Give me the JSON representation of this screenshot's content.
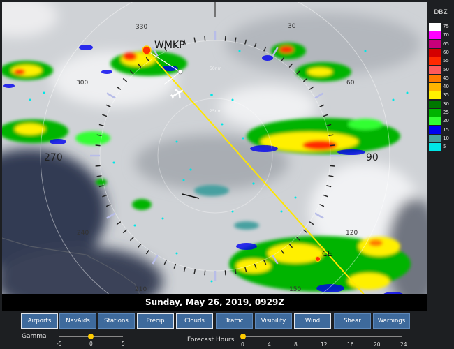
{
  "timestamp": "Sunday, May 26, 2019, 0929Z",
  "legend": {
    "title": "DBZ",
    "entries": [
      {
        "value": "75",
        "color": "#ffffff"
      },
      {
        "value": "70",
        "color": "#ff00ff"
      },
      {
        "value": "65",
        "color": "#c8007a"
      },
      {
        "value": "60",
        "color": "#d40000"
      },
      {
        "value": "55",
        "color": "#ff2a00"
      },
      {
        "value": "50",
        "color": "#ff5a5a"
      },
      {
        "value": "45",
        "color": "#ff7a00"
      },
      {
        "value": "40",
        "color": "#ffb400"
      },
      {
        "value": "35",
        "color": "#fff000"
      },
      {
        "value": "30",
        "color": "#007800"
      },
      {
        "value": "25",
        "color": "#00b400"
      },
      {
        "value": "20",
        "color": "#32ff32"
      },
      {
        "value": "15",
        "color": "#0000f0"
      },
      {
        "value": "10",
        "color": "#46a0a0"
      },
      {
        "value": "5",
        "color": "#00e6e6"
      }
    ]
  },
  "compass": {
    "bearings": [
      "330",
      "30",
      "270",
      "90",
      "240",
      "210",
      "120",
      "60",
      "300",
      "150"
    ],
    "ranges": [
      "75nm",
      "50nm",
      "25nm"
    ]
  },
  "waypoints": {
    "origin": "WMKP",
    "destination": "CE"
  },
  "toolbar": {
    "buttons": [
      {
        "label": "Airports",
        "active": true
      },
      {
        "label": "NavAids",
        "active": false
      },
      {
        "label": "Stations",
        "active": false
      },
      {
        "label": "Precip",
        "active": true
      },
      {
        "label": "Clouds",
        "active": true
      },
      {
        "label": "Traffic",
        "active": false
      },
      {
        "label": "Visibility",
        "active": false
      },
      {
        "label": "Wind",
        "active": true
      },
      {
        "label": "Shear",
        "active": false
      },
      {
        "label": "Warnings",
        "active": false
      }
    ]
  },
  "gamma": {
    "label": "Gamma",
    "ticks": [
      "-5",
      "0",
      "5"
    ],
    "value": 0
  },
  "forecast": {
    "label": "Forecast Hours",
    "ticks": [
      "0",
      "4",
      "8",
      "12",
      "16",
      "20",
      "24"
    ],
    "value": 0
  },
  "colors": {
    "route": "#ffe600",
    "waypoint": "#ff3300",
    "button": "#3e6a9c"
  }
}
